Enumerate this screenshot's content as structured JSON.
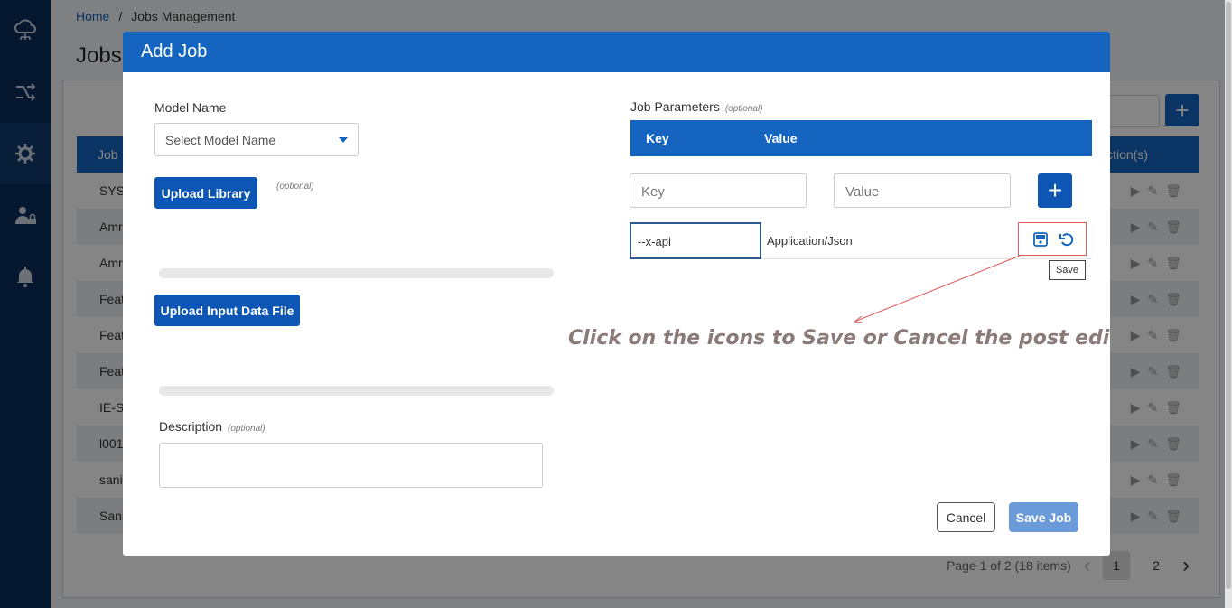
{
  "breadcrumb": {
    "home": "Home",
    "separator": "/",
    "current": "Jobs Management"
  },
  "page": {
    "title": "Jobs"
  },
  "sidebar": {
    "items": [
      {
        "icon": "cloud-network-icon"
      },
      {
        "icon": "shuffle-icon"
      },
      {
        "icon": "gear-wrench-icon",
        "active": true
      },
      {
        "icon": "user-lock-icon"
      },
      {
        "icon": "bell-icon"
      }
    ]
  },
  "table": {
    "header_job": "Job",
    "header_actions": "ction(s)",
    "rows": [
      "SYS",
      "Amr",
      "Amr",
      "Feat",
      "Feat",
      "Feat",
      "IE-Si",
      "l001",
      "sani",
      "Sani"
    ]
  },
  "pagination": {
    "summary": "Page 1 of 2 (18 items)",
    "pages": [
      "1",
      "2"
    ],
    "current": "1"
  },
  "modal": {
    "title": "Add Job",
    "model_name_label": "Model Name",
    "model_select_placeholder": "Select Model Name",
    "upload_library": "Upload Library",
    "upload_library_optional": "(optional)",
    "upload_input": "Upload Input Data File",
    "description_label": "Description",
    "description_optional": "(optional)",
    "job_params_label": "Job Parameters",
    "job_params_optional": "(optional)",
    "param_header_key": "Key",
    "param_header_value": "Value",
    "key_placeholder": "Key",
    "value_placeholder": "Value",
    "edit_row": {
      "key": "--x-api",
      "value": "Application/Json"
    },
    "tooltip": "Save",
    "annotation": "Click on the icons to Save or Cancel the post edit changes",
    "cancel": "Cancel",
    "save_job": "Save Job"
  },
  "colors": {
    "primary": "#1565c0",
    "sidebar": "#0d2f5a",
    "annotation": "#8a7a78",
    "highlight": "#e05a5a"
  }
}
